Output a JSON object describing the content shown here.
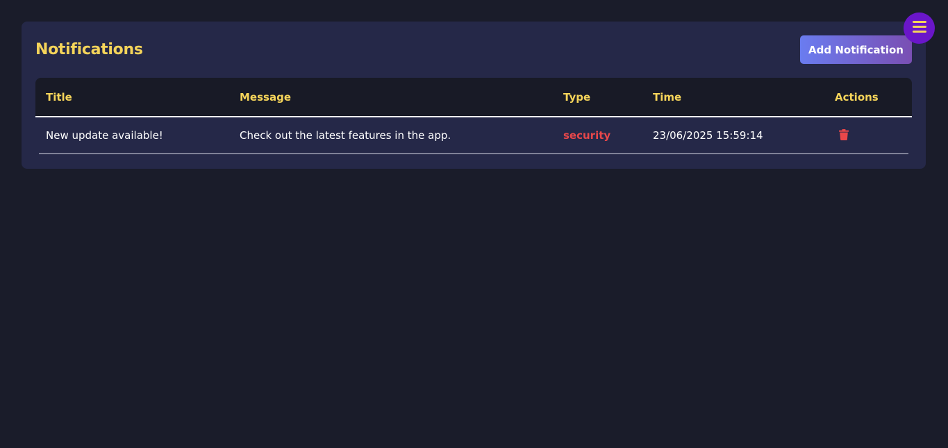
{
  "header": {
    "title": "Notifications",
    "add_button_label": "Add Notification"
  },
  "table": {
    "columns": [
      "Title",
      "Message",
      "Type",
      "Time",
      "Actions"
    ],
    "rows": [
      {
        "title": "New update available!",
        "message": "Check out the latest features in the app.",
        "type": "security",
        "time": "23/06/2025 15:59:14",
        "action_icon": "trash-icon"
      }
    ]
  },
  "menu": {
    "icon": "hamburger-menu-icon"
  },
  "colors": {
    "background": "#1a1c2a",
    "panel": "#252848",
    "accent_yellow": "#f5d45a",
    "type_security": "#e8474a",
    "menu_button": "#6a16c9"
  }
}
